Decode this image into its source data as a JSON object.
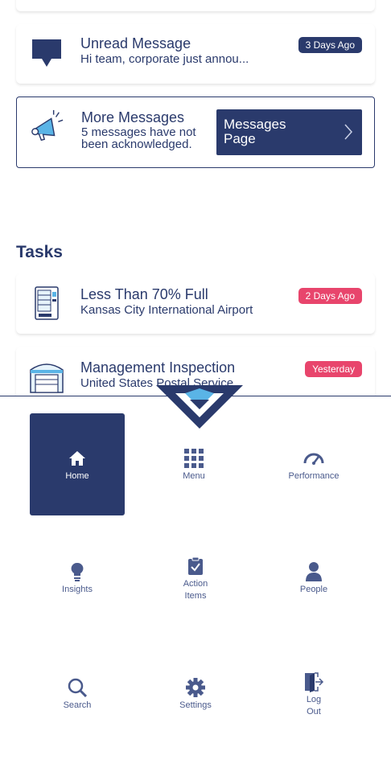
{
  "unread": {
    "title": "Unread Message",
    "preview": "Hi team, corporate just annou...",
    "badge": "3 Days Ago"
  },
  "more": {
    "title": "More Messages",
    "description": "5 messages have not been acknowledged.",
    "button_label": "Messages Page"
  },
  "tasks": {
    "heading": "Tasks",
    "items": [
      {
        "title": "Less Than 70% Full",
        "location": "Kansas City International Airport",
        "badge": "2 Days Ago"
      },
      {
        "title": "Management Inspection",
        "location": "United States Postal Service",
        "badge": "Yesterday"
      }
    ]
  },
  "nav": {
    "items": [
      {
        "label": "Home",
        "icon": "home-icon",
        "active": true
      },
      {
        "label": "Menu",
        "icon": "grid-icon",
        "active": false
      },
      {
        "label": "Performance",
        "icon": "gauge-icon",
        "active": false
      },
      {
        "label": "Insights",
        "icon": "lightbulb-icon",
        "active": false
      },
      {
        "label": "Action Items",
        "icon": "clipboard-check-icon",
        "active": false
      },
      {
        "label": "People",
        "icon": "person-icon",
        "active": false
      },
      {
        "label": "Search",
        "icon": "search-icon",
        "active": false
      },
      {
        "label": "Settings",
        "icon": "gear-icon",
        "active": false
      },
      {
        "label": "Log Out",
        "icon": "logout-icon",
        "active": false
      }
    ]
  },
  "colors": {
    "navy": "#2a3a6c",
    "badge_red": "#e8456c",
    "icon_light_blue": "#5ab4e6"
  }
}
